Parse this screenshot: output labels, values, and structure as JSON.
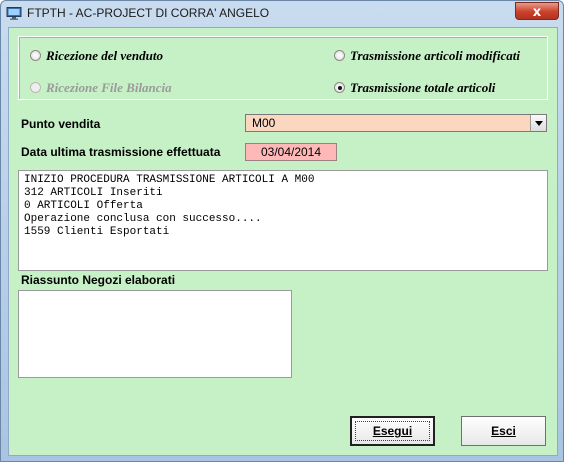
{
  "window": {
    "title": "FTPTH - AC-PROJECT DI CORRA' ANGELO",
    "close_glyph": "x",
    "app_icon": "monitor-icon",
    "close_icon": "close-icon"
  },
  "options": [
    {
      "label": "Ricezione del venduto",
      "checked": false,
      "enabled": true
    },
    {
      "label": "Trasmissione articoli modificati",
      "checked": false,
      "enabled": true
    },
    {
      "label": "Ricezione File Bilancia",
      "checked": false,
      "enabled": false
    },
    {
      "label": "Trasmissione totale articoli",
      "checked": true,
      "enabled": true
    }
  ],
  "punto_vendita": {
    "label": "Punto vendita",
    "value": "M00"
  },
  "data_trasmissione": {
    "label": "Data ultima trasmissione effettuata",
    "value": "03/04/2014"
  },
  "log": {
    "lines": [
      "INIZIO PROCEDURA TRASMISSIONE ARTICOLI A M00",
      "312 ARTICOLI Inseriti",
      "0 ARTICOLI Offerta",
      "Operazione conclusa con successo....",
      "1559 Clienti Esportati"
    ]
  },
  "riassunto": {
    "label": "Riassunto Negozi elaborati"
  },
  "buttons": {
    "esegui": "Esegui",
    "esci": "Esci"
  },
  "colors": {
    "client_background": "#c6f0c6",
    "select_background": "#fbd7c0",
    "date_background": "#ffb8b8",
    "close_button": "#c9412c"
  }
}
